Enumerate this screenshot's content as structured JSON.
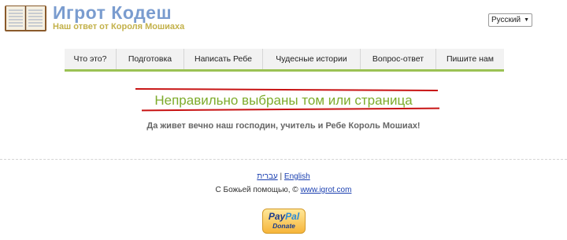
{
  "header": {
    "site_title": "Игрот Кодеш",
    "site_subtitle": "Наш ответ от Короля Мошиаха",
    "logo_icon": "open-book-icon",
    "language_select": {
      "selected": "Русский"
    }
  },
  "nav": {
    "items": [
      {
        "label": "Что это?"
      },
      {
        "label": "Подготовка"
      },
      {
        "label": "Написать Ребе"
      },
      {
        "label": "Чудесные истории"
      },
      {
        "label": "Вопрос-ответ"
      },
      {
        "label": "Пишите нам"
      }
    ],
    "accent_color": "#9bc254"
  },
  "main": {
    "error_title": "Неправильно выбраны том или страница",
    "blessing": "Да живет вечно наш господин, учитель и Ребе Король Мошиах!",
    "error_color": "#7dab2b",
    "annotation_color": "#c81414"
  },
  "footer": {
    "lang_hebrew": "עברית",
    "separator": "|",
    "lang_english": "English",
    "copyright_prefix": "С Божьей помощью,  ©",
    "copyright_link": "www.igrot.com",
    "paypal": {
      "brand_part1": "Pay",
      "brand_part2": "Pal",
      "donate_label": "Donate"
    }
  }
}
